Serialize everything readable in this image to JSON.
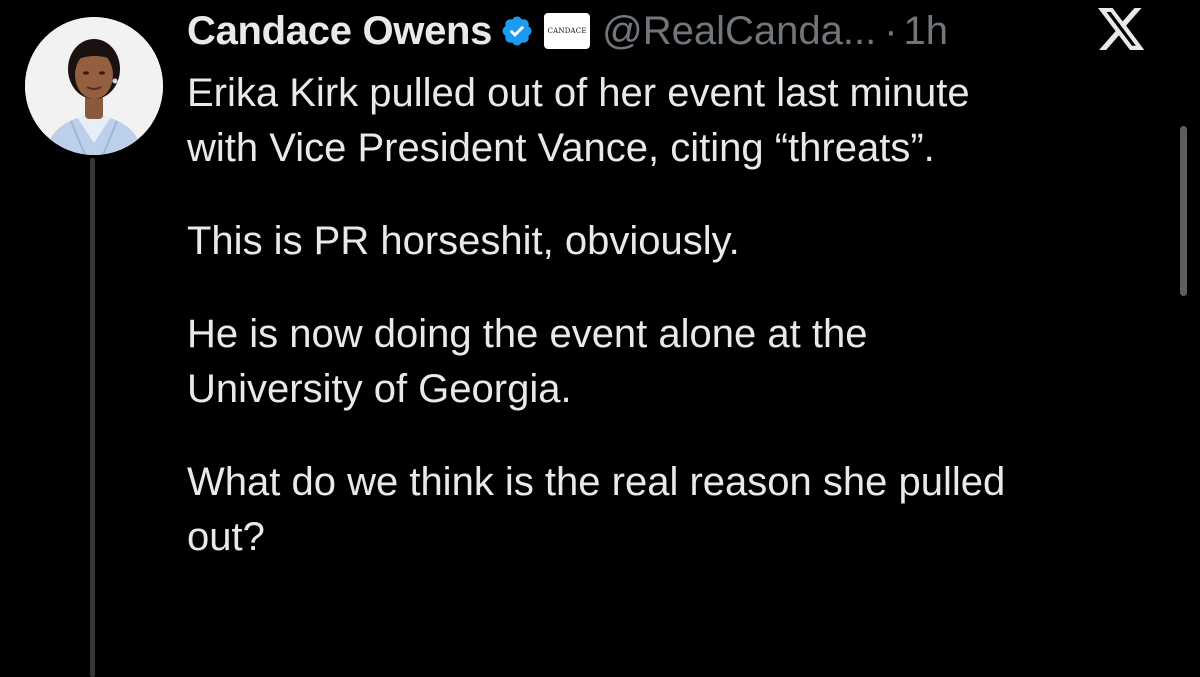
{
  "tweet": {
    "display_name": "Candace Owens",
    "affiliate_badge_text": "CANDACE",
    "handle": "@RealCanda...",
    "separator": "·",
    "time": "1h",
    "paragraphs": [
      [
        "Erika Kirk pulled out of her event last minute",
        "with Vice President Vance, citing “threats”."
      ],
      [
        "This is PR horseshit, obviously."
      ],
      [
        "He is now doing the event alone at the",
        "University of Georgia."
      ],
      [
        "What do we think is the real reason she pulled",
        "out?"
      ]
    ]
  },
  "icons": {
    "verified": "verified-badge-icon",
    "platform": "x-logo-icon"
  },
  "colors": {
    "background": "#000000",
    "text_primary": "#e7e9ea",
    "text_secondary": "#71767b",
    "verified_blue": "#1d9bf0",
    "thread_line": "#333639"
  }
}
